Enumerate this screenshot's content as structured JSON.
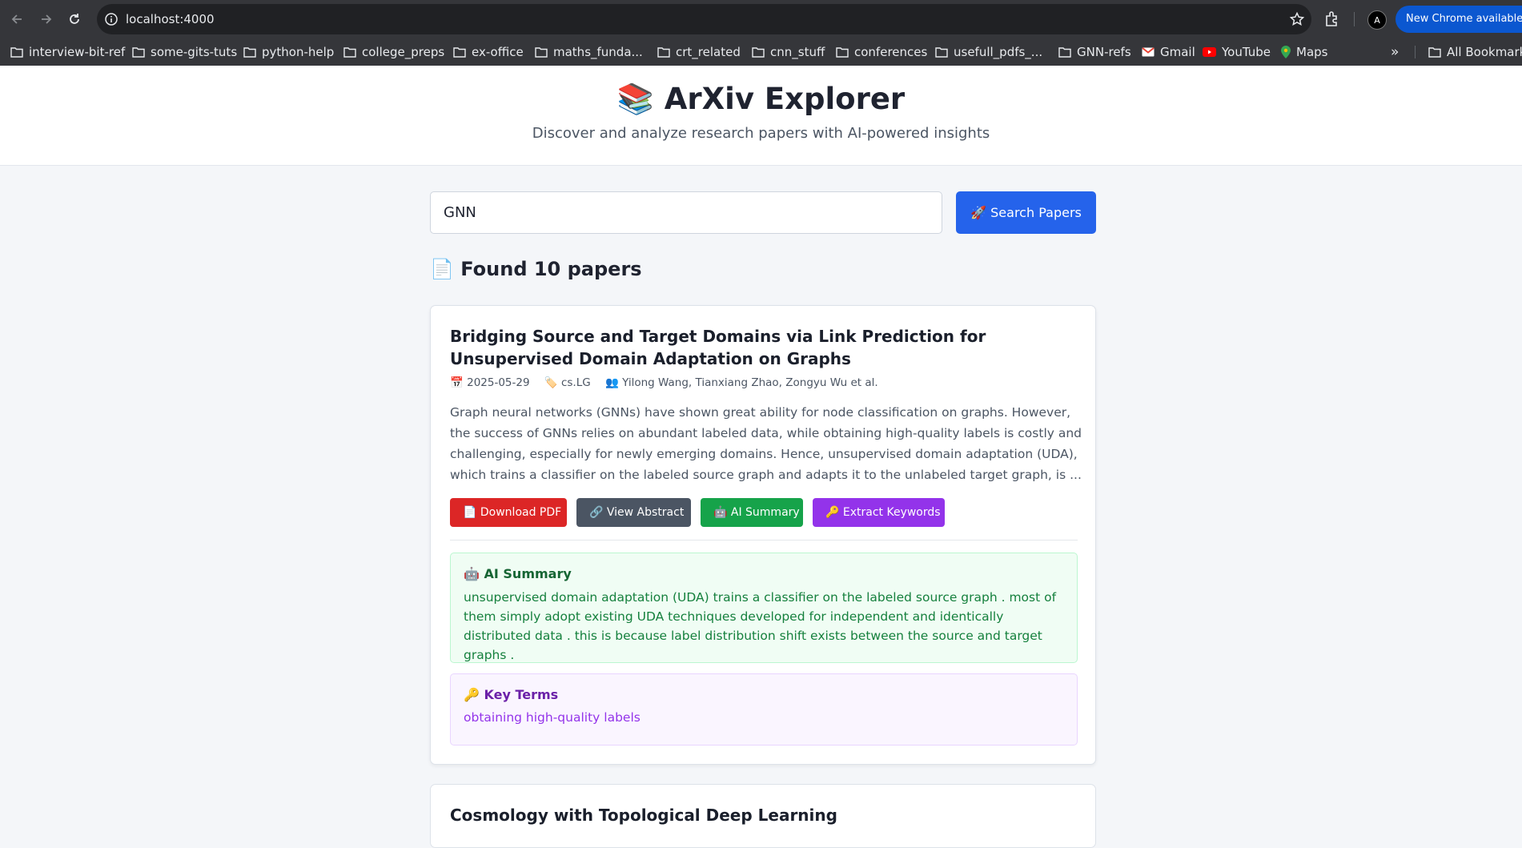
{
  "browser": {
    "url": "localhost:4000",
    "update_label": "New Chrome available",
    "profile_initial": "A"
  },
  "bookmarks": {
    "items": [
      {
        "label": "interview-bit-ref",
        "icon": "folder-icon"
      },
      {
        "label": "some-gits-tuts",
        "icon": "folder-icon"
      },
      {
        "label": "python-help",
        "icon": "folder-icon"
      },
      {
        "label": "college_preps",
        "icon": "folder-icon"
      },
      {
        "label": "ex-office",
        "icon": "folder-icon"
      },
      {
        "label": "maths_funda...",
        "icon": "folder-icon"
      },
      {
        "label": "crt_related",
        "icon": "folder-icon"
      },
      {
        "label": "cnn_stuff",
        "icon": "folder-icon"
      },
      {
        "label": "conferences",
        "icon": "folder-icon"
      },
      {
        "label": "usefull_pdfs_...",
        "icon": "folder-icon"
      },
      {
        "label": "GNN-refs",
        "icon": "folder-icon"
      },
      {
        "label": "Gmail",
        "icon": "gmail-icon"
      },
      {
        "label": "YouTube",
        "icon": "youtube-icon"
      },
      {
        "label": "Maps",
        "icon": "maps-icon"
      }
    ],
    "more_label": "»",
    "all_bookmarks_label": "All Bookmarks"
  },
  "header": {
    "title": "📚 ArXiv Explorer",
    "subtitle": "Discover and analyze research papers with AI-powered insights"
  },
  "search": {
    "value": "GNN",
    "button_label": "🚀 Search Papers"
  },
  "results": {
    "heading": "📄 Found 10 papers",
    "papers": [
      {
        "title": "Bridging Source and Target Domains via Link Prediction for Unsupervised Domain Adaptation on Graphs",
        "date": "📅 2025-05-29",
        "category": "🏷️ cs.LG",
        "authors": "👥 Yilong Wang, Tianxiang Zhao, Zongyu Wu et al.",
        "abstract": "Graph neural networks (GNNs) have shown great ability for node classification on graphs. However, the success of GNNs relies on abundant labeled data, while obtaining high-quality labels is costly and challenging, especially for newly emerging domains. Hence, unsupervised domain adaptation (UDA), which trains a classifier on the labeled source graph and adapts it to the unlabeled target graph, is ...",
        "actions": {
          "download": "📄 Download PDF",
          "view": "🔗 View Abstract",
          "summary": "🤖 AI Summary",
          "keywords": "🔑 Extract Keywords"
        },
        "summary_heading": "🤖 AI Summary",
        "summary_text": "unsupervised domain adaptation (UDA) trains a classifier on the labeled source graph . most of them simply adopt existing UDA techniques developed for independent and identically distributed data . this is because label distribution shift exists between the source and target graphs .",
        "keyterms_heading": "🔑 Key Terms",
        "keyterms_text": "obtaining high-quality labels"
      },
      {
        "title": "Cosmology with Topological Deep Learning"
      }
    ]
  },
  "colors": {
    "primary": "#2563eb",
    "danger": "#dc2626",
    "neutral": "#4b5563",
    "success": "#16a34a",
    "accent": "#9333ea"
  }
}
